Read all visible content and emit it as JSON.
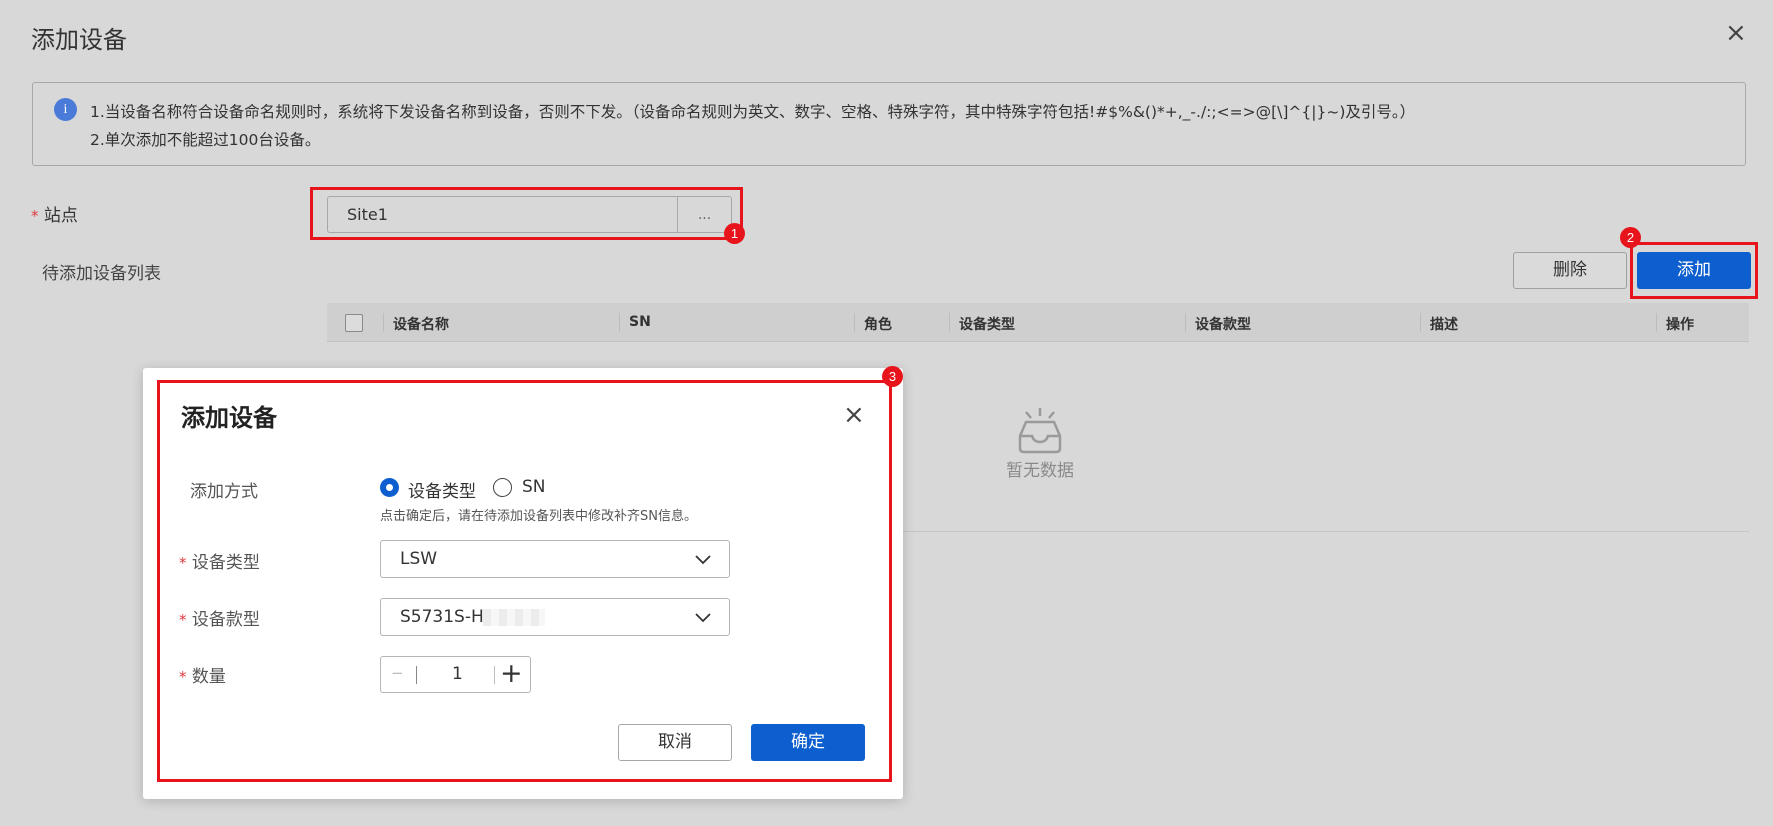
{
  "page": {
    "title": "添加设备",
    "close_glyph": "×"
  },
  "info": {
    "icon_glyph": "i",
    "line1": "1.当设备名称符合设备命名规则时，系统将下发设备名称到设备，否则不下发。（设备命名规则为英文、数字、空格、特殊字符，其中特殊字符包括!#$%&()*+,_-./:;<=>@[\\]^{|}~)及引号。）",
    "line2": "2.单次添加不能超过100台设备。"
  },
  "site": {
    "required_mark": "*",
    "label": "站点",
    "value": "Site1",
    "browse_label": "..."
  },
  "list": {
    "title": "待添加设备列表",
    "delete_label": "删除",
    "add_label": "添加",
    "columns": [
      "设备名称",
      "SN",
      "角色",
      "设备类型",
      "设备款型",
      "描述",
      "操作"
    ],
    "empty_text": "暂无数据"
  },
  "dialog": {
    "title": "添加设备",
    "close_glyph": "×",
    "method_label": "添加方式",
    "method_options": [
      "设备类型",
      "SN"
    ],
    "method_selected": "设备类型",
    "hint": "点击确定后，请在待添加设备列表中修改补齐SN信息。",
    "required_mark": "*",
    "type_label": "设备类型",
    "type_value": "LSW",
    "model_label": "设备款型",
    "model_value": "S5731S-H4",
    "qty_label": "数量",
    "qty_value": "1",
    "qty_minus": "−",
    "qty_plus": "+",
    "cancel_label": "取消",
    "confirm_label": "确定"
  },
  "annotations": [
    "1",
    "2",
    "3"
  ],
  "colors": {
    "primary": "#0d5fcf",
    "annotation": "#e8141b",
    "required": "#e0393e",
    "info_icon": "#4a7bd8",
    "overlay_bg": "#d8d8d8"
  }
}
